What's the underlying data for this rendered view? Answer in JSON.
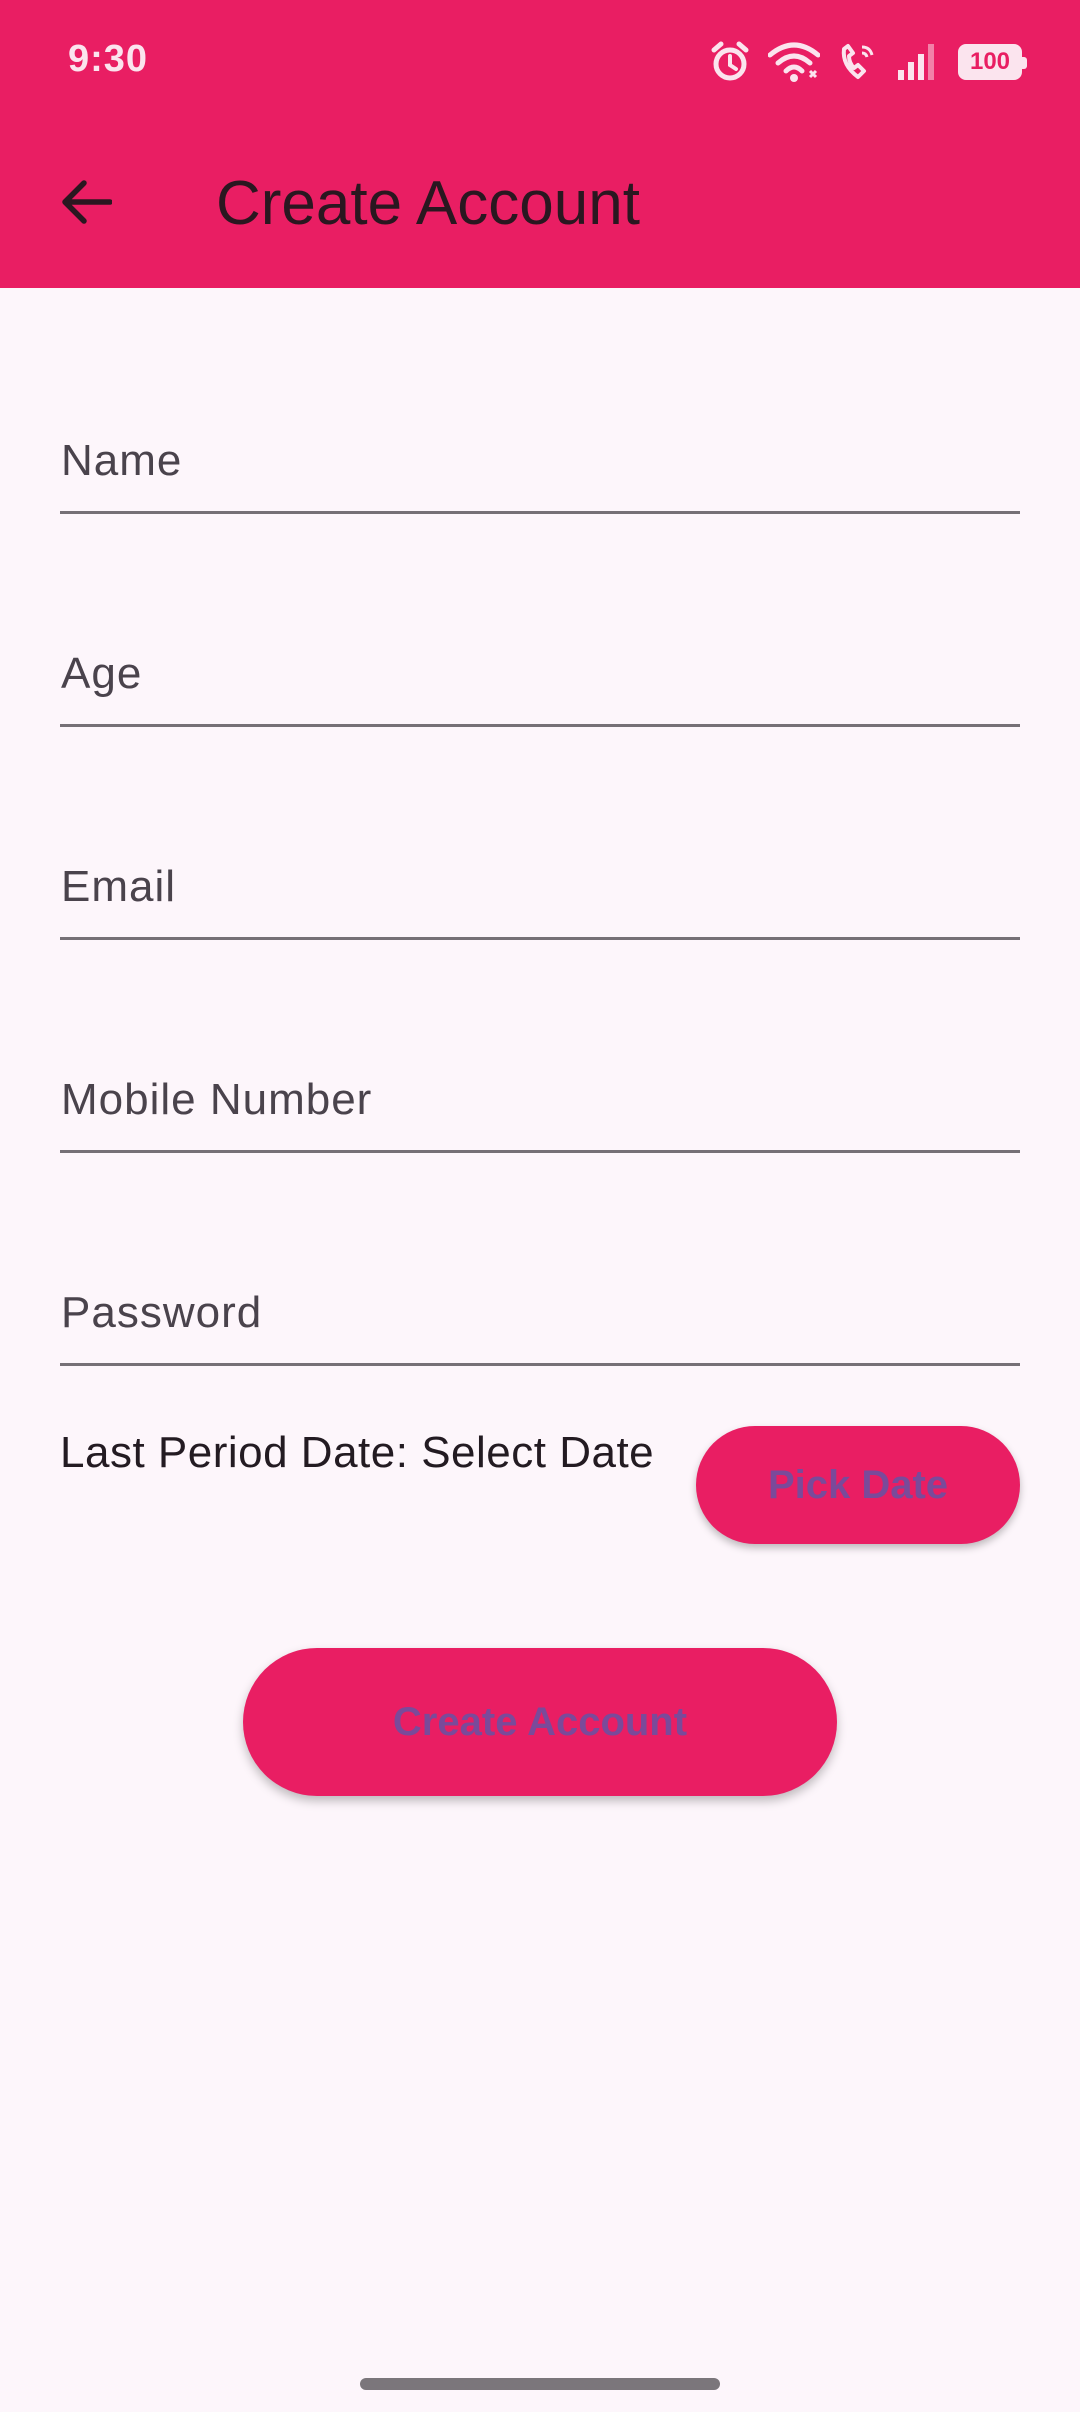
{
  "status_bar": {
    "time": "9:30",
    "battery": "100",
    "icons": [
      "alarm-icon",
      "wifi-icon",
      "wifi-call-icon",
      "signal-icon",
      "battery-icon"
    ]
  },
  "app_bar": {
    "title": "Create Account",
    "back_icon": "arrow-back-icon"
  },
  "form": {
    "name_placeholder": "Name",
    "age_placeholder": "Age",
    "email_placeholder": "Email",
    "mobile_placeholder": "Mobile Number",
    "password_placeholder": "Password",
    "last_period_label": "Last Period Date: Select Date",
    "pick_date_button": "Pick Date",
    "create_account_button": "Create Account"
  },
  "colors": {
    "primary": "#e91e63",
    "background": "#fdf6fb",
    "button_text": "#7a4a9a"
  }
}
